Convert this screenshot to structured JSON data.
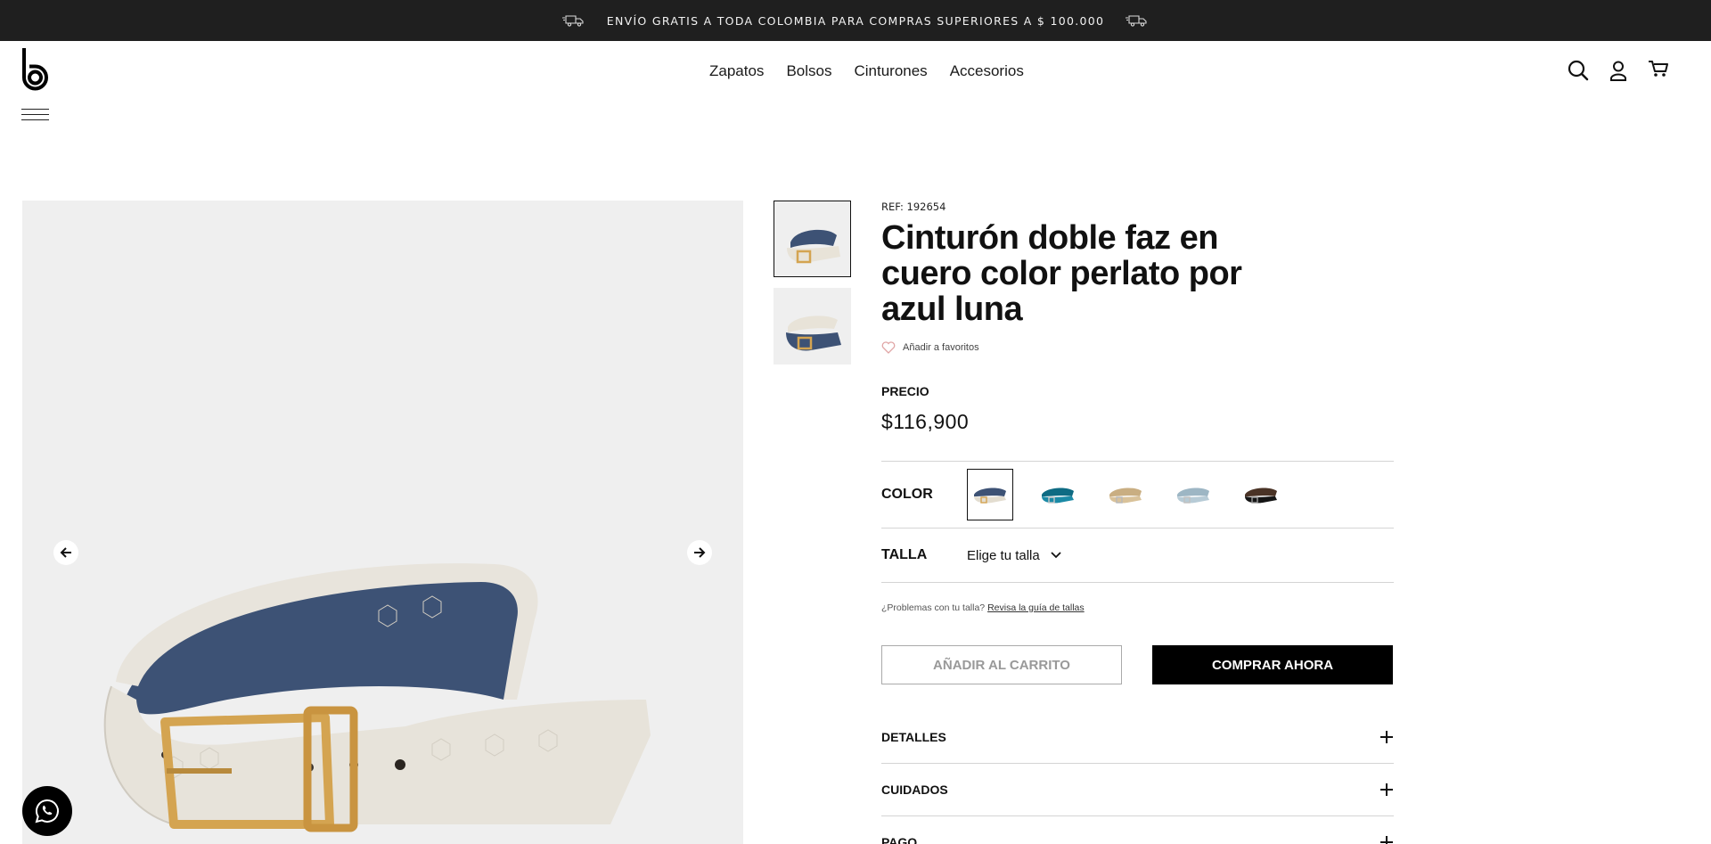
{
  "announcement": {
    "text": "ENVÍO GRATIS A TODA COLOMBIA PARA COMPRAS SUPERIORES A $ 100.000",
    "left_icon": "truck-icon",
    "right_icon": "truck-icon"
  },
  "header": {
    "logo": "b-logo",
    "nav": [
      "Zapatos",
      "Bolsos",
      "Cinturones",
      "Accesorios"
    ],
    "icons": [
      "search-icon",
      "user-icon",
      "cart-icon"
    ]
  },
  "product": {
    "ref": "REF: 192654",
    "title": "Cinturón doble faz en cuero color perlato por azul luna",
    "favorite_label": "Añadir a favoritos",
    "price_label": "PRECIO",
    "price": "$116,900",
    "color_label": "COLOR",
    "colors": [
      {
        "name": "perlato-azul",
        "primary": "#e9e4da",
        "secondary": "#3b4e6e",
        "selected": true
      },
      {
        "name": "turquesa",
        "primary": "#1b8aa6",
        "secondary": "#0e6b83",
        "selected": false
      },
      {
        "name": "beige",
        "primary": "#d9c29a",
        "secondary": "#c9ae82",
        "selected": false
      },
      {
        "name": "celeste",
        "primary": "#b7cbd6",
        "secondary": "#9db6c4",
        "selected": false
      },
      {
        "name": "cafe-negro",
        "primary": "#4a3326",
        "secondary": "#151515",
        "selected": false
      }
    ],
    "size_label": "TALLA",
    "size_select": "Elige tu talla",
    "size_help": "¿Problemas con tu talla?",
    "size_help_link": "Revisa la guía de tallas",
    "add_to_cart": "AÑADIR AL CARRITO",
    "buy_now": "COMPRAR AHORA",
    "accordions": [
      "DETALLES",
      "CUIDADOS",
      "PAGO"
    ]
  },
  "gallery": {
    "thumbnails": 2,
    "active_thumbnail": 1
  },
  "colors": {
    "topbar_bg": "#1f1f1f",
    "image_bg": "#efefef",
    "accent": "#000000",
    "heart": "#e0a5a5"
  }
}
